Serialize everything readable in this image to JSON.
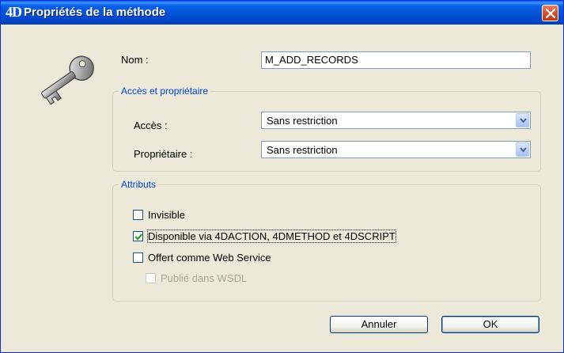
{
  "window": {
    "app_logo": "4D",
    "title": "Propriétés de la méthode"
  },
  "icons": {
    "dialog_icon": "key-icon",
    "close": "close-icon",
    "dropdown": "chevron-down-icon",
    "check": "checkmark-icon"
  },
  "colors": {
    "titlebar": "#0453d6",
    "close_button": "#d8502f",
    "group_title": "#0046d5",
    "window_bg": "#ece9d8"
  },
  "name_field": {
    "label": "Nom :",
    "value": "M_ADD_RECORDS"
  },
  "access_group": {
    "title": "Accès et propriétaire",
    "access_label": "Accès :",
    "access_value": "Sans restriction",
    "owner_label": "Propriétaire :",
    "owner_value": "Sans restriction"
  },
  "attributes_group": {
    "title": "Attributs",
    "invisible": {
      "label": "Invisible",
      "checked": false
    },
    "available_4daction": {
      "label": "Disponible via 4DACTION, 4DMETHOD et 4DSCRIPT",
      "checked": true
    },
    "web_service": {
      "label": "Offert comme Web Service",
      "checked": false
    },
    "published_wsdl": {
      "label": "Publié dans WSDL",
      "checked": false,
      "enabled": false
    }
  },
  "buttons": {
    "cancel": "Annuler",
    "ok": "OK"
  }
}
